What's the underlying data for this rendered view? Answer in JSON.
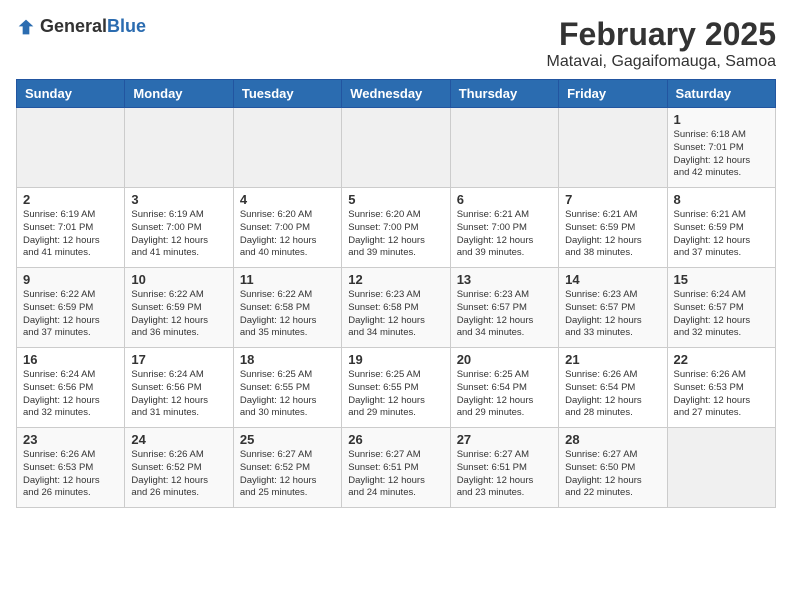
{
  "logo": {
    "text_general": "General",
    "text_blue": "Blue"
  },
  "title": "February 2025",
  "subtitle": "Matavai, Gagaifomauga, Samoa",
  "days_of_week": [
    "Sunday",
    "Monday",
    "Tuesday",
    "Wednesday",
    "Thursday",
    "Friday",
    "Saturday"
  ],
  "weeks": [
    [
      {
        "day": "",
        "info": ""
      },
      {
        "day": "",
        "info": ""
      },
      {
        "day": "",
        "info": ""
      },
      {
        "day": "",
        "info": ""
      },
      {
        "day": "",
        "info": ""
      },
      {
        "day": "",
        "info": ""
      },
      {
        "day": "1",
        "info": "Sunrise: 6:18 AM\nSunset: 7:01 PM\nDaylight: 12 hours\nand 42 minutes."
      }
    ],
    [
      {
        "day": "2",
        "info": "Sunrise: 6:19 AM\nSunset: 7:01 PM\nDaylight: 12 hours\nand 41 minutes."
      },
      {
        "day": "3",
        "info": "Sunrise: 6:19 AM\nSunset: 7:00 PM\nDaylight: 12 hours\nand 41 minutes."
      },
      {
        "day": "4",
        "info": "Sunrise: 6:20 AM\nSunset: 7:00 PM\nDaylight: 12 hours\nand 40 minutes."
      },
      {
        "day": "5",
        "info": "Sunrise: 6:20 AM\nSunset: 7:00 PM\nDaylight: 12 hours\nand 39 minutes."
      },
      {
        "day": "6",
        "info": "Sunrise: 6:21 AM\nSunset: 7:00 PM\nDaylight: 12 hours\nand 39 minutes."
      },
      {
        "day": "7",
        "info": "Sunrise: 6:21 AM\nSunset: 6:59 PM\nDaylight: 12 hours\nand 38 minutes."
      },
      {
        "day": "8",
        "info": "Sunrise: 6:21 AM\nSunset: 6:59 PM\nDaylight: 12 hours\nand 37 minutes."
      }
    ],
    [
      {
        "day": "9",
        "info": "Sunrise: 6:22 AM\nSunset: 6:59 PM\nDaylight: 12 hours\nand 37 minutes."
      },
      {
        "day": "10",
        "info": "Sunrise: 6:22 AM\nSunset: 6:59 PM\nDaylight: 12 hours\nand 36 minutes."
      },
      {
        "day": "11",
        "info": "Sunrise: 6:22 AM\nSunset: 6:58 PM\nDaylight: 12 hours\nand 35 minutes."
      },
      {
        "day": "12",
        "info": "Sunrise: 6:23 AM\nSunset: 6:58 PM\nDaylight: 12 hours\nand 34 minutes."
      },
      {
        "day": "13",
        "info": "Sunrise: 6:23 AM\nSunset: 6:57 PM\nDaylight: 12 hours\nand 34 minutes."
      },
      {
        "day": "14",
        "info": "Sunrise: 6:23 AM\nSunset: 6:57 PM\nDaylight: 12 hours\nand 33 minutes."
      },
      {
        "day": "15",
        "info": "Sunrise: 6:24 AM\nSunset: 6:57 PM\nDaylight: 12 hours\nand 32 minutes."
      }
    ],
    [
      {
        "day": "16",
        "info": "Sunrise: 6:24 AM\nSunset: 6:56 PM\nDaylight: 12 hours\nand 32 minutes."
      },
      {
        "day": "17",
        "info": "Sunrise: 6:24 AM\nSunset: 6:56 PM\nDaylight: 12 hours\nand 31 minutes."
      },
      {
        "day": "18",
        "info": "Sunrise: 6:25 AM\nSunset: 6:55 PM\nDaylight: 12 hours\nand 30 minutes."
      },
      {
        "day": "19",
        "info": "Sunrise: 6:25 AM\nSunset: 6:55 PM\nDaylight: 12 hours\nand 29 minutes."
      },
      {
        "day": "20",
        "info": "Sunrise: 6:25 AM\nSunset: 6:54 PM\nDaylight: 12 hours\nand 29 minutes."
      },
      {
        "day": "21",
        "info": "Sunrise: 6:26 AM\nSunset: 6:54 PM\nDaylight: 12 hours\nand 28 minutes."
      },
      {
        "day": "22",
        "info": "Sunrise: 6:26 AM\nSunset: 6:53 PM\nDaylight: 12 hours\nand 27 minutes."
      }
    ],
    [
      {
        "day": "23",
        "info": "Sunrise: 6:26 AM\nSunset: 6:53 PM\nDaylight: 12 hours\nand 26 minutes."
      },
      {
        "day": "24",
        "info": "Sunrise: 6:26 AM\nSunset: 6:52 PM\nDaylight: 12 hours\nand 26 minutes."
      },
      {
        "day": "25",
        "info": "Sunrise: 6:27 AM\nSunset: 6:52 PM\nDaylight: 12 hours\nand 25 minutes."
      },
      {
        "day": "26",
        "info": "Sunrise: 6:27 AM\nSunset: 6:51 PM\nDaylight: 12 hours\nand 24 minutes."
      },
      {
        "day": "27",
        "info": "Sunrise: 6:27 AM\nSunset: 6:51 PM\nDaylight: 12 hours\nand 23 minutes."
      },
      {
        "day": "28",
        "info": "Sunrise: 6:27 AM\nSunset: 6:50 PM\nDaylight: 12 hours\nand 22 minutes."
      },
      {
        "day": "",
        "info": ""
      }
    ]
  ]
}
